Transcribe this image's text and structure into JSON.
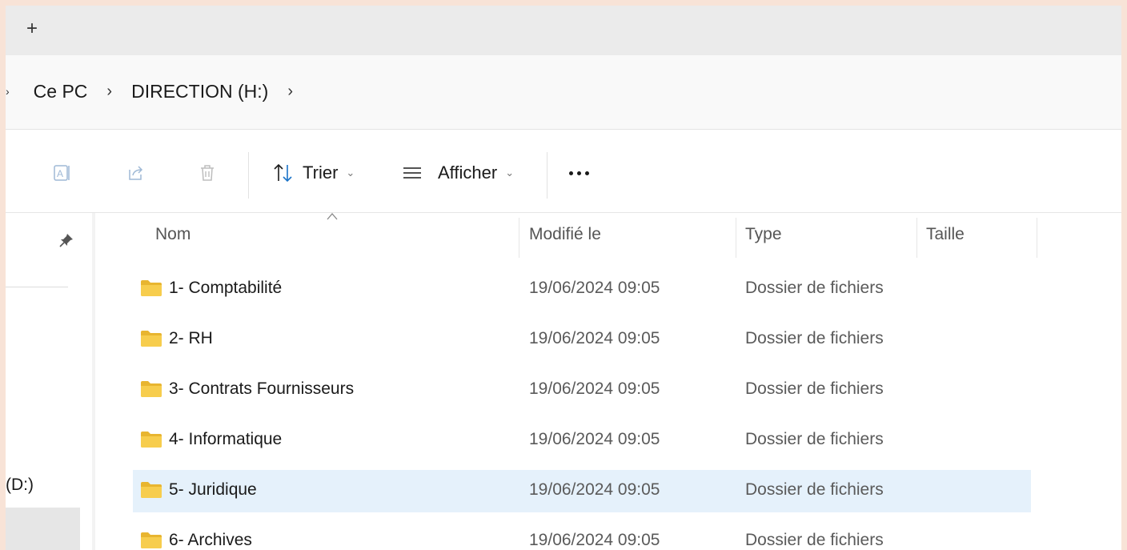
{
  "tabbar": {
    "new_tab_label": "+"
  },
  "breadcrumb": {
    "items": [
      "Ce PC",
      "DIRECTION (H:)"
    ]
  },
  "toolbar": {
    "sort_label": "Trier",
    "view_label": "Afficher"
  },
  "nav": {
    "drive_label": "(D:)"
  },
  "columns": {
    "name": "Nom",
    "modified": "Modifié le",
    "type": "Type",
    "size": "Taille"
  },
  "files": [
    {
      "name": "1- Comptabilité",
      "modified": "19/06/2024 09:05",
      "type": "Dossier de fichiers",
      "size": ""
    },
    {
      "name": "2- RH",
      "modified": "19/06/2024 09:05",
      "type": "Dossier de fichiers",
      "size": ""
    },
    {
      "name": "3- Contrats Fournisseurs",
      "modified": "19/06/2024 09:05",
      "type": "Dossier de fichiers",
      "size": ""
    },
    {
      "name": "4- Informatique",
      "modified": "19/06/2024 09:05",
      "type": "Dossier de fichiers",
      "size": ""
    },
    {
      "name": "5- Juridique",
      "modified": "19/06/2024 09:05",
      "type": "Dossier de fichiers",
      "size": ""
    },
    {
      "name": "6- Archives",
      "modified": "19/06/2024 09:05",
      "type": "Dossier de fichiers",
      "size": ""
    }
  ],
  "selected_file": "5- Juridique",
  "colors": {
    "selection": "#e5f1fb",
    "folder": "#f5c842",
    "page_border": "#f8e3d7"
  }
}
